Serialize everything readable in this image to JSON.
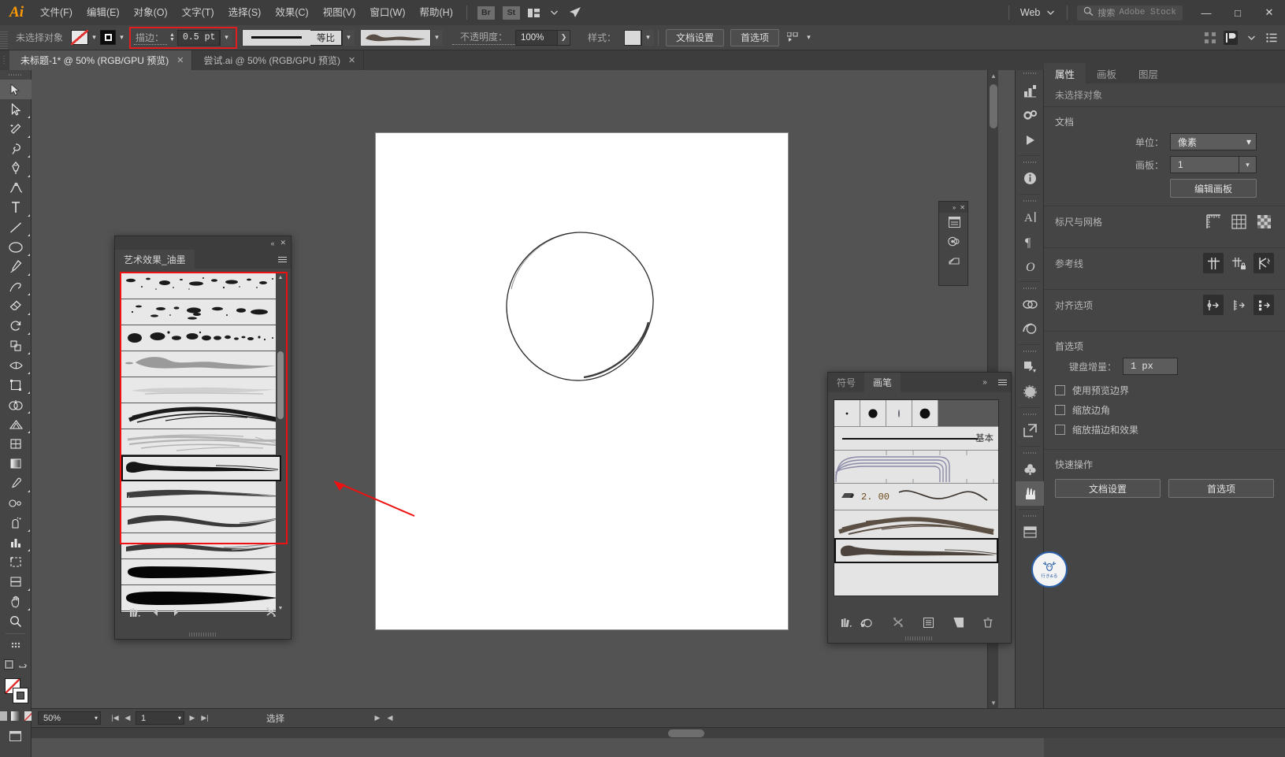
{
  "app": {
    "name": "Adobe Illustrator",
    "logo": "Ai"
  },
  "menubar": {
    "items": [
      {
        "label": "文件(F)",
        "name": "menu-file"
      },
      {
        "label": "编辑(E)",
        "name": "menu-edit"
      },
      {
        "label": "对象(O)",
        "name": "menu-object"
      },
      {
        "label": "文字(T)",
        "name": "menu-type"
      },
      {
        "label": "选择(S)",
        "name": "menu-select"
      },
      {
        "label": "效果(C)",
        "name": "menu-effect"
      },
      {
        "label": "视图(V)",
        "name": "menu-view"
      },
      {
        "label": "窗口(W)",
        "name": "menu-window"
      },
      {
        "label": "帮助(H)",
        "name": "menu-help"
      }
    ],
    "bridge_badge": "Br",
    "stock_badge": "St",
    "workspace": "Web",
    "search_label": "搜索",
    "search_target": "Adobe Stock",
    "window_buttons": {
      "minimize": "—",
      "maximize": "□",
      "close": "✕"
    }
  },
  "controlbar": {
    "selection_status": "未选择对象",
    "stroke_label": "描边：",
    "stroke_value": "0.5 pt",
    "profile_label": "等比",
    "opacity_label": "不透明度：",
    "opacity_value": "100%",
    "style_label": "样式：",
    "doc_setup_button": "文档设置",
    "preferences_button": "首选项"
  },
  "tabs": [
    {
      "label": "未标题-1* @ 50% (RGB/GPU 预览)",
      "active": true,
      "close": "✕"
    },
    {
      "label": "尝试.ai @ 50% (RGB/GPU 预览)",
      "active": false,
      "close": "✕"
    }
  ],
  "toolbar": {
    "tools": [
      {
        "name": "selection-tool",
        "icon": "cursor"
      },
      {
        "name": "direct-selection-tool",
        "icon": "direct-cursor"
      },
      {
        "name": "magic-wand-tool",
        "icon": "wand"
      },
      {
        "name": "lasso-tool",
        "icon": "lasso"
      },
      {
        "name": "pen-tool",
        "icon": "pen"
      },
      {
        "name": "curvature-tool",
        "icon": "curvature"
      },
      {
        "name": "type-tool",
        "icon": "type-T"
      },
      {
        "name": "line-segment-tool",
        "icon": "line"
      },
      {
        "name": "ellipse-tool",
        "icon": "ellipse"
      },
      {
        "name": "paintbrush-tool",
        "icon": "paintbrush"
      },
      {
        "name": "shaper-tool",
        "icon": "shaper"
      },
      {
        "name": "eraser-tool",
        "icon": "eraser"
      },
      {
        "name": "rotate-tool",
        "icon": "rotate"
      },
      {
        "name": "scale-tool",
        "icon": "scale"
      },
      {
        "name": "width-tool",
        "icon": "width"
      },
      {
        "name": "free-transform-tool",
        "icon": "free-transform"
      },
      {
        "name": "shape-builder-tool",
        "icon": "shape-builder"
      },
      {
        "name": "perspective-grid-tool",
        "icon": "perspective"
      },
      {
        "name": "mesh-tool",
        "icon": "mesh"
      },
      {
        "name": "gradient-tool",
        "icon": "gradient"
      },
      {
        "name": "eyedropper-tool",
        "icon": "eyedropper"
      },
      {
        "name": "blend-tool",
        "icon": "blend"
      },
      {
        "name": "symbol-sprayer-tool",
        "icon": "symbol-sprayer"
      },
      {
        "name": "column-graph-tool",
        "icon": "bar-chart"
      },
      {
        "name": "artboard-tool",
        "icon": "artboard"
      },
      {
        "name": "slice-tool",
        "icon": "slice"
      },
      {
        "name": "hand-tool",
        "icon": "hand"
      },
      {
        "name": "zoom-tool",
        "icon": "magnifier"
      }
    ]
  },
  "ink_panel": {
    "title": "艺术效果_油墨",
    "selected_index": 7,
    "rows": [
      {
        "name": "ink-brush-splatter-fine",
        "style": "spatter-fine"
      },
      {
        "name": "ink-brush-splatter-medium",
        "style": "spatter-med"
      },
      {
        "name": "ink-brush-dots",
        "style": "dots"
      },
      {
        "name": "ink-brush-wash-gray",
        "style": "wash-gray"
      },
      {
        "name": "ink-brush-wash-light",
        "style": "wash-light"
      },
      {
        "name": "ink-brush-dry-dark",
        "style": "dry-dark"
      },
      {
        "name": "ink-brush-dry-light",
        "style": "dry-light"
      },
      {
        "name": "ink-brush-tapered-blob",
        "style": "tapered-blob"
      },
      {
        "name": "ink-brush-flat-stroke",
        "style": "flat-stroke"
      },
      {
        "name": "ink-brush-wave-stroke",
        "style": "wave-stroke"
      },
      {
        "name": "ink-brush-thick-wave",
        "style": "thick-wave"
      },
      {
        "name": "ink-brush-solid-taper-1",
        "style": "solid-taper-1"
      },
      {
        "name": "ink-brush-solid-taper-2",
        "style": "solid-taper-2"
      },
      {
        "name": "ink-brush-solid-taper-3",
        "style": "solid-taper-3"
      }
    ],
    "footer_icons": [
      "library-icon",
      "prev-icon",
      "next-icon",
      "delete-icon"
    ]
  },
  "brush_panel": {
    "tabs": [
      {
        "label": "符号",
        "active": false,
        "name": "tab-symbols"
      },
      {
        "label": "画笔",
        "active": true,
        "name": "tab-brushes"
      }
    ],
    "calligraphic": [
      {
        "name": "calligraphic-brush-1pt",
        "size": "small-dot"
      },
      {
        "name": "calligraphic-brush-3pt",
        "size": "med-dot"
      },
      {
        "name": "calligraphic-brush-oval",
        "size": "thin-line"
      },
      {
        "name": "calligraphic-brush-5pt",
        "size": "large-dot"
      }
    ],
    "basic_label": "基本",
    "pattern_value": "2. 00",
    "selected_index": 4,
    "rows": [
      {
        "name": "brush-basic-line",
        "style": "basic"
      },
      {
        "name": "brush-pattern-rope",
        "style": "pattern"
      },
      {
        "name": "brush-art-charcoal",
        "style": "art-wave"
      },
      {
        "name": "brush-art-dry-ink",
        "style": "art-dry"
      },
      {
        "name": "brush-art-tapered-blob",
        "style": "art-blob"
      }
    ],
    "footer_icons": [
      "library-icon",
      "libraries-icon",
      "remove-brush-stroke-icon",
      "options-icon",
      "new-brush-icon",
      "delete-brush-icon"
    ]
  },
  "mini_panel": {
    "icons": [
      "artboards-icon",
      "color-guide-icon",
      "asset-export-icon"
    ]
  },
  "rail": {
    "icons": [
      "properties-icon",
      "gear-icon",
      "play-icon",
      "info-icon",
      "character-icon",
      "paragraph-icon",
      "glyphs-icon",
      "links-icon",
      "libraries-icon",
      "transform-icon",
      "transparency-icon",
      "export-icon",
      "symbols-icon",
      "brushes-icon",
      "swatches-icon",
      "gradient-panel-icon"
    ]
  },
  "properties": {
    "tabs": [
      {
        "label": "属性",
        "active": true,
        "name": "tab-properties"
      },
      {
        "label": "画板",
        "active": false,
        "name": "tab-artboards"
      },
      {
        "label": "图层",
        "active": false,
        "name": "tab-layers"
      }
    ],
    "no_selection": "未选择对象",
    "document": {
      "section": "文档",
      "unit_label": "单位：",
      "unit_value": "像素",
      "artboard_label": "画板：",
      "artboard_value": "1",
      "edit_artboards_button": "编辑画板"
    },
    "rulers": {
      "label": "标尺与网格",
      "icons": [
        "rulers-icon",
        "grid-icon",
        "transparency-grid-icon"
      ]
    },
    "guides": {
      "label": "参考线",
      "icons": [
        "show-guides-icon",
        "lock-guides-icon",
        "smart-guides-icon"
      ]
    },
    "align": {
      "label": "对齐选项",
      "icons": [
        "align-to-point-icon",
        "align-to-pixel-icon",
        "align-to-grid-icon"
      ]
    },
    "preferences": {
      "section": "首选项",
      "keyboard_increment_label": "键盘增量：",
      "keyboard_increment_value": "1 px",
      "checkboxes": [
        {
          "label": "使用预览边界",
          "checked": false,
          "name": "use-preview-bounds-checkbox"
        },
        {
          "label": "缩放边角",
          "checked": false,
          "name": "scale-corners-checkbox"
        },
        {
          "label": "缩放描边和效果",
          "checked": false,
          "name": "scale-strokes-effects-checkbox"
        }
      ]
    },
    "quick_actions": {
      "section": "快速操作",
      "doc_setup": "文档设置",
      "preferences": "首选项"
    }
  },
  "statusbar": {
    "zoom": "50%",
    "page": "1",
    "status_text": "选择"
  },
  "watermark": {
    "line1": "行き&る"
  },
  "colors": {
    "accent_red": "#ef1111",
    "chrome_bg": "#454545",
    "canvas_bg": "#535353",
    "panel_list_bg": "#e8e8e8",
    "logo_orange": "#ff9a00"
  }
}
